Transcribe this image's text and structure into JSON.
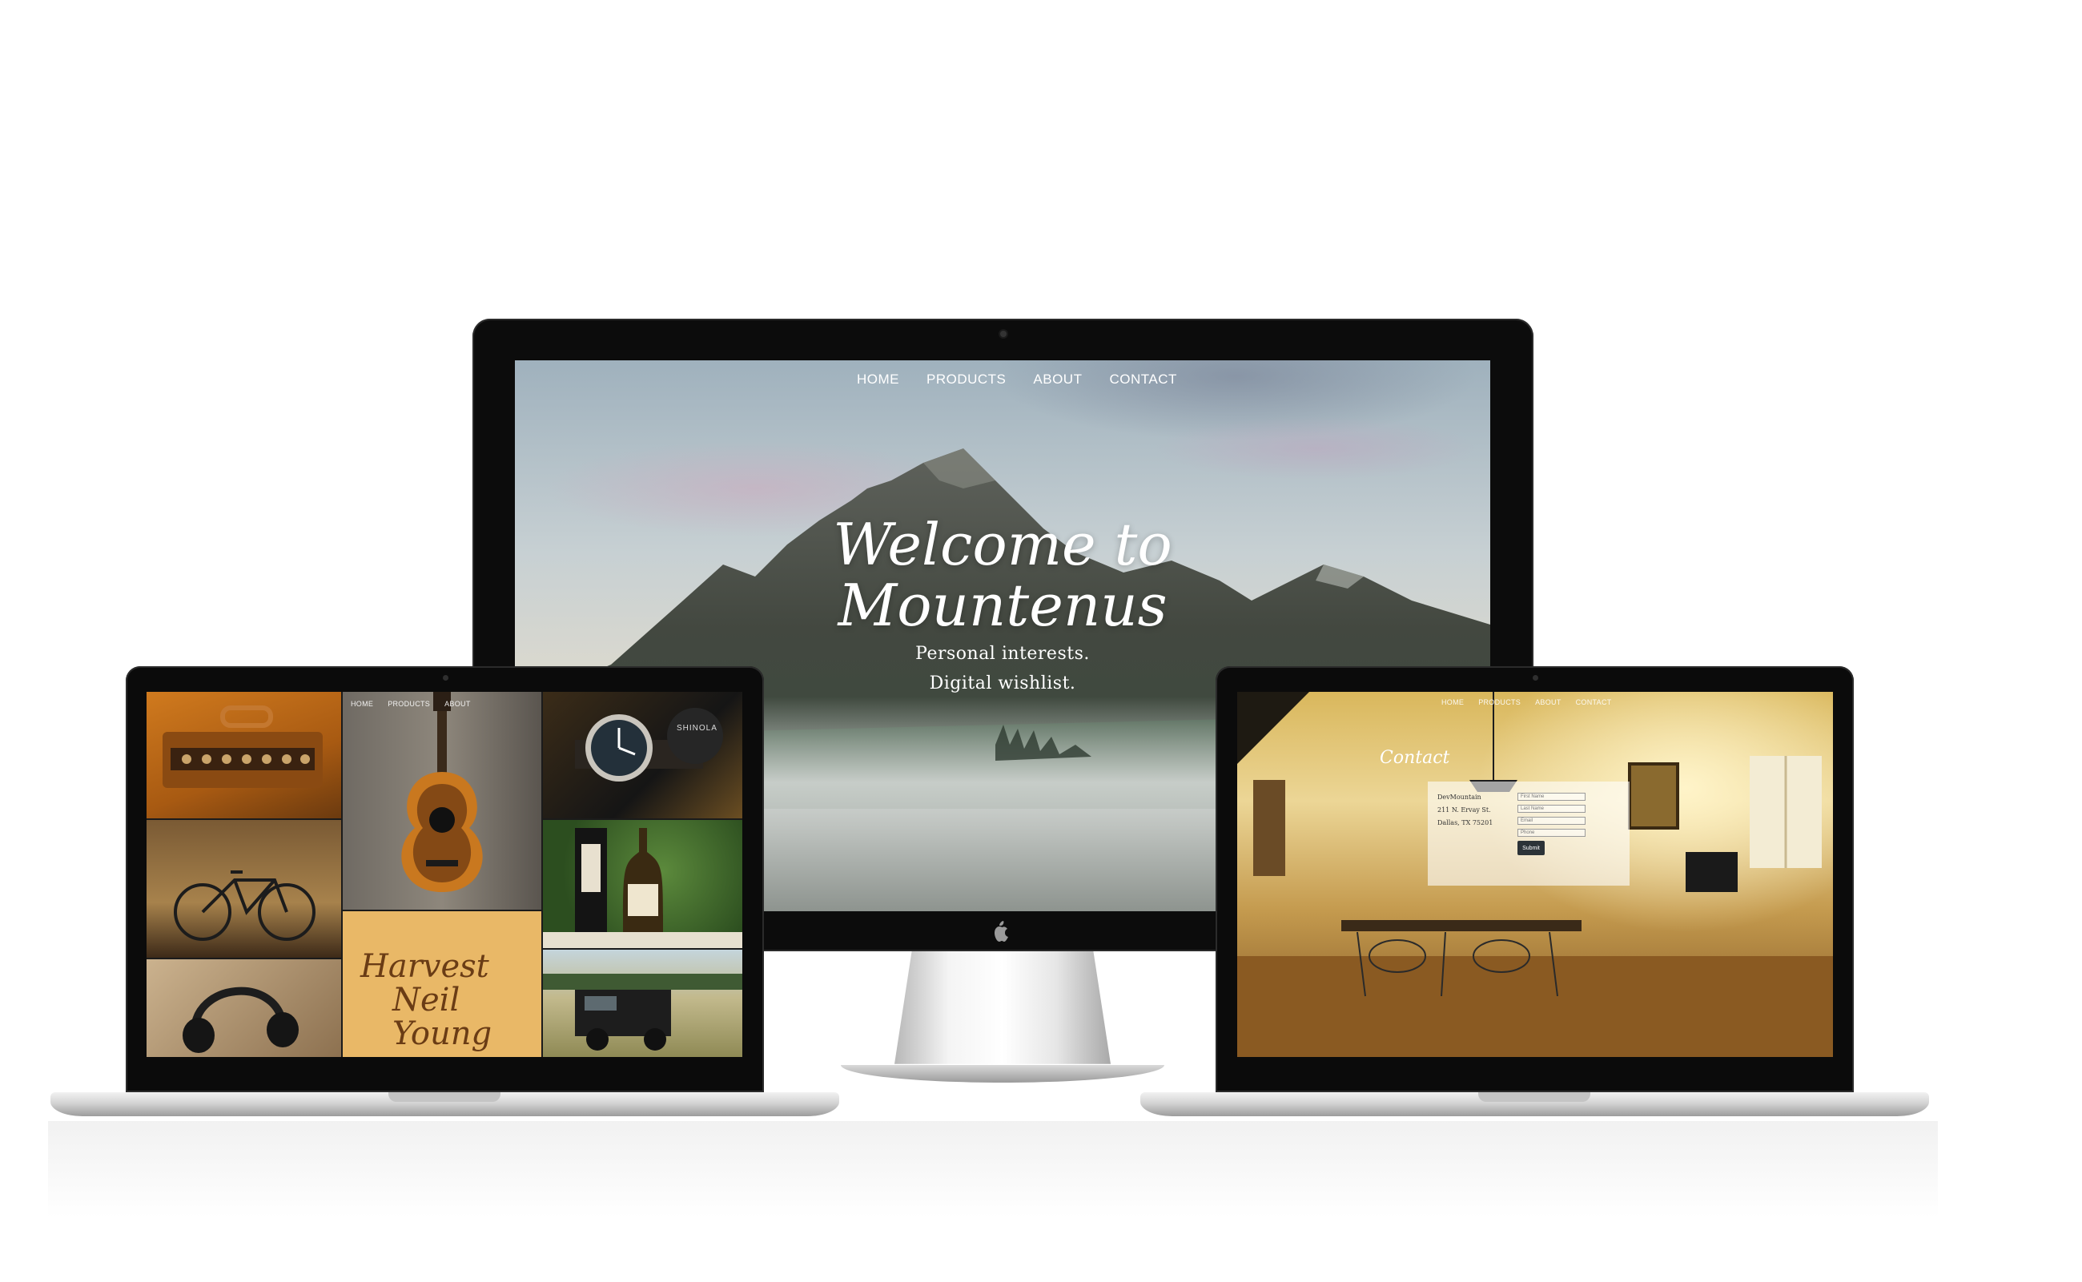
{
  "desktop": {
    "nav": [
      "HOME",
      "PRODUCTS",
      "ABOUT",
      "CONTACT"
    ],
    "hero_line1": "Welcome to",
    "hero_line2": "Mountenus",
    "tagline_line1": "Personal interests.",
    "tagline_line2": "Digital wishlist."
  },
  "left_laptop": {
    "nav": [
      "HOME",
      "PRODUCTS",
      "ABOUT"
    ],
    "album_text_line1": "Harvest",
    "album_text_line2": "Neil Young",
    "watch_brand": "SHINOLA"
  },
  "right_laptop": {
    "nav": [
      "HOME",
      "PRODUCTS",
      "ABOUT",
      "CONTACT"
    ],
    "section_title": "Contact",
    "address": [
      "DevMountain",
      "211 N. Ervay St.",
      "Dallas, TX 75201"
    ],
    "form_placeholders": [
      "First Name",
      "Last Name",
      "Email",
      "Phone"
    ],
    "submit_label": "Submit"
  },
  "colors": {
    "bezel": "#0c0c0c",
    "sky": "#c7d0d3",
    "mountain": "#4a5048",
    "interior_warm": "#e6c97a"
  }
}
